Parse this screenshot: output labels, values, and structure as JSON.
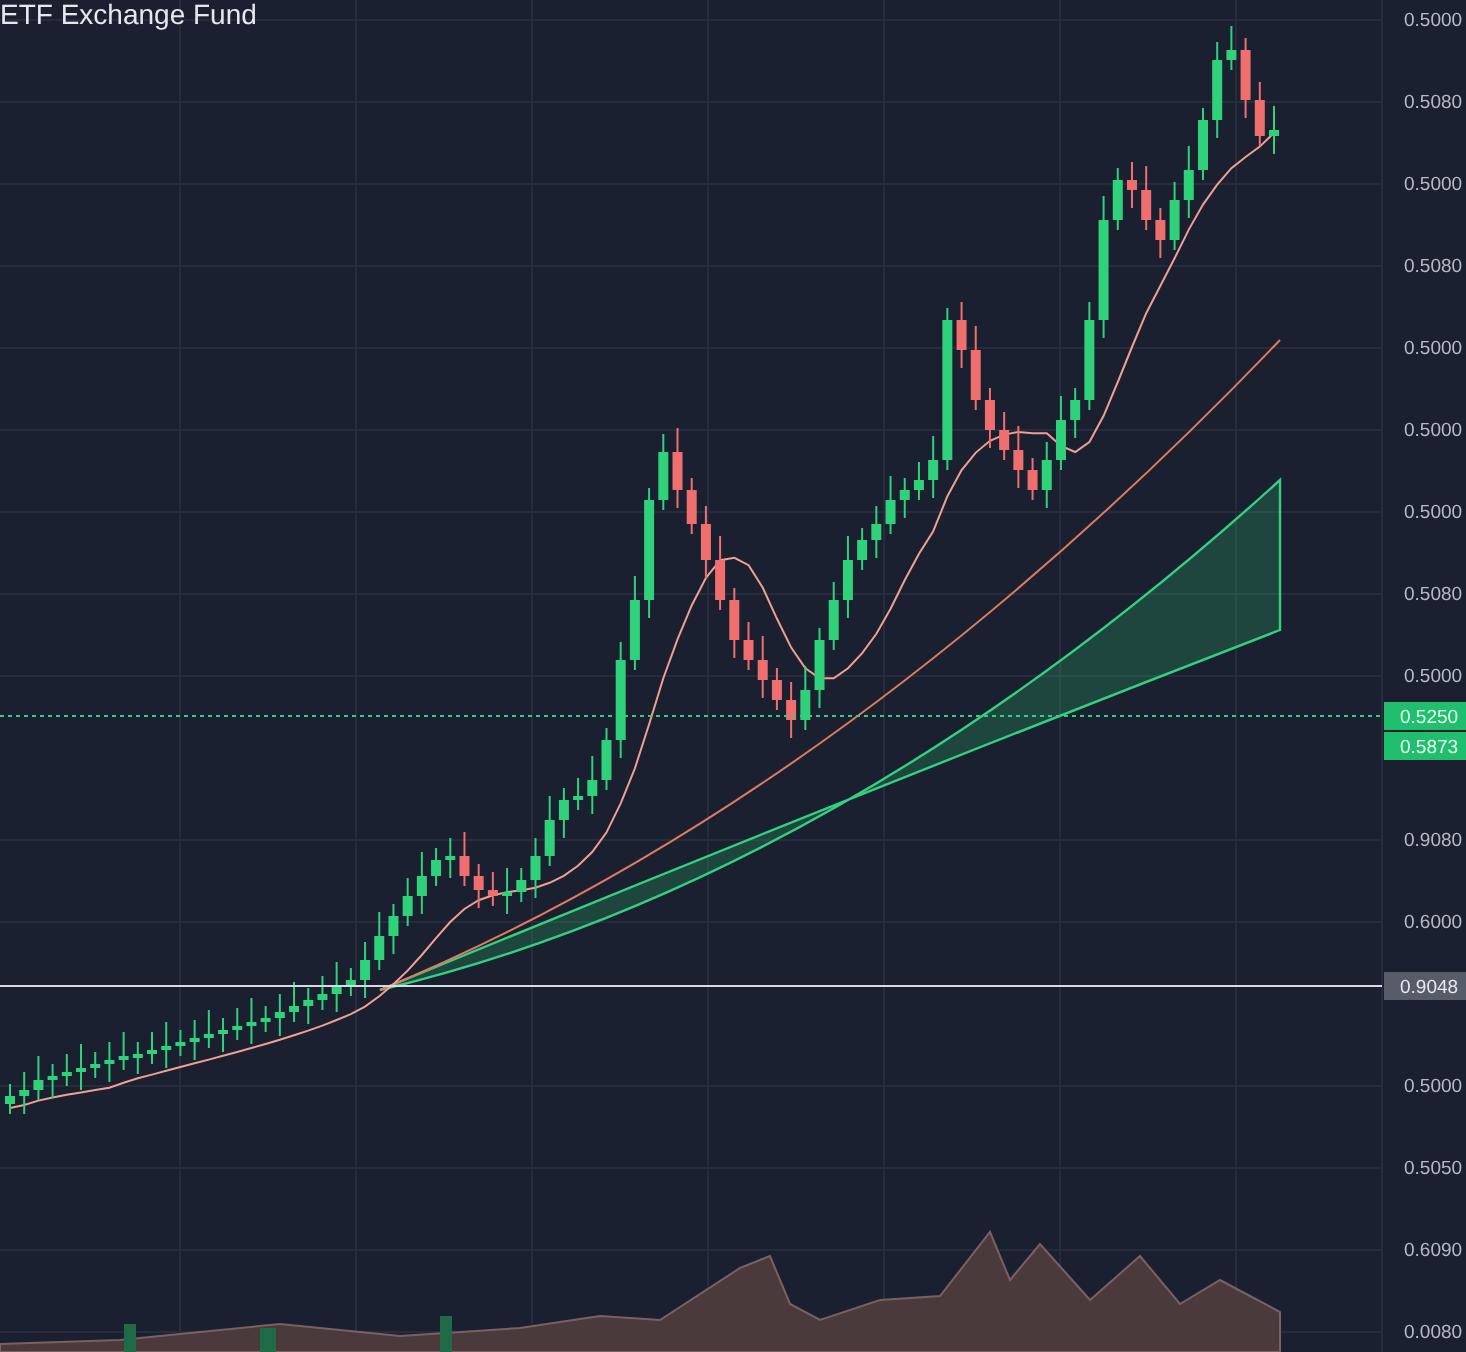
{
  "title": "ETF Exchange Fund",
  "price_axis": {
    "labels": [
      "0.5000",
      "0.5080",
      "0.5000",
      "0.5080",
      "0.5000",
      "0.5000",
      "0.5000",
      "0.5080",
      "0.5000",
      "0.9080",
      "0.6000",
      "0.5000",
      "0.5050",
      "0.6090",
      "0.0080"
    ]
  },
  "badges": [
    {
      "label": "0.5250",
      "kind": "last"
    },
    {
      "label": "0.5873",
      "kind": "last"
    },
    {
      "label": "0.9048",
      "kind": "crosshair"
    }
  ]
}
